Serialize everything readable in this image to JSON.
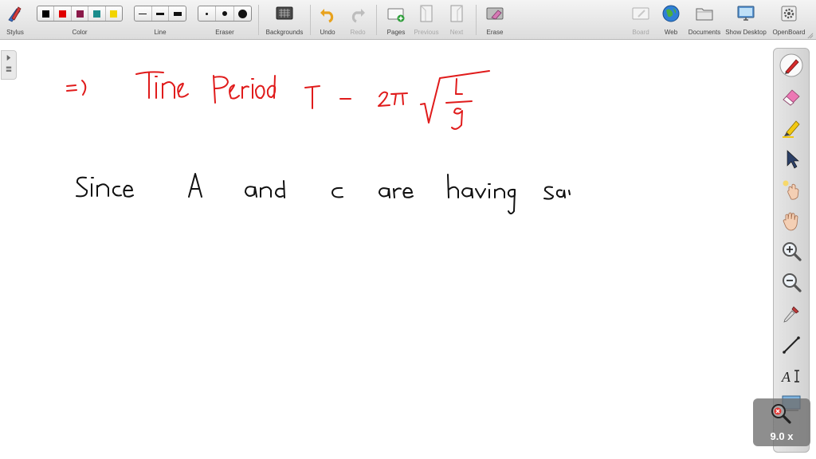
{
  "toolbar": {
    "stylus": "Stylus",
    "color": "Color",
    "line": "Line",
    "eraser": "Eraser",
    "backgrounds": "Backgrounds",
    "undo": "Undo",
    "redo": "Redo",
    "pages": "Pages",
    "previous": "Previous",
    "next": "Next",
    "erase": "Erase",
    "board": "Board",
    "web": "Web",
    "documents": "Documents",
    "show_desktop": "Show Desktop",
    "openboard": "OpenBoard"
  },
  "colors": [
    "#000000",
    "#e00000",
    "#8b1a4a",
    "#1a8c8c",
    "#f2d400"
  ],
  "palette_tools": [
    "pen-icon",
    "eraser-icon",
    "highlighter-icon",
    "pointer-icon",
    "laser-pointer-icon",
    "hand-icon",
    "zoom-in-icon",
    "zoom-out-icon",
    "pipette-icon",
    "line-icon",
    "text-icon",
    "capture-icon"
  ],
  "zoom": {
    "label": "9.0 x"
  }
}
